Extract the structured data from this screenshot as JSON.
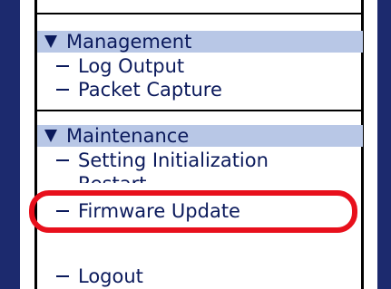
{
  "menu": {
    "management": {
      "header": "Management",
      "items": [
        "Log Output",
        "Packet Capture"
      ]
    },
    "maintenance": {
      "header": "Maintenance",
      "items": [
        "Setting Initialization",
        "Restart",
        "Firmware Update"
      ]
    },
    "logout": "Logout"
  },
  "colors": {
    "frame": "#1c2a6e",
    "header_bg": "#b8c7e6",
    "text": "#0b1a5c",
    "highlight": "#e8101c"
  }
}
